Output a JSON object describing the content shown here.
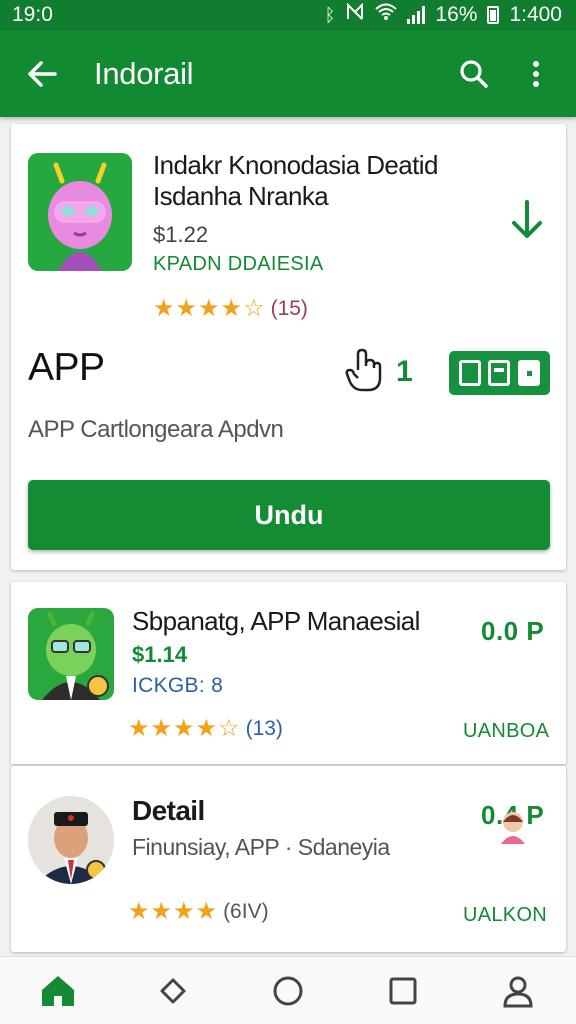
{
  "status_bar": {
    "time_left": "19:0",
    "battery": "16%",
    "time_right": "1:400",
    "icons": [
      "bluetooth-icon",
      "mute-icon",
      "wifi-icon",
      "signal-icon",
      "battery-icon"
    ]
  },
  "app_bar": {
    "title": "Indorail",
    "icons": [
      "back-arrow-icon",
      "search-icon",
      "more-vert-icon"
    ]
  },
  "featured": {
    "title_line1": "Indakr Knonodasia Deatid",
    "title_line2": "Isdanha Nranka",
    "price": "$1.22",
    "developer": "KPADN DDAIESIA",
    "stars": "★★★★☆",
    "rating_count": "(15)",
    "app_label": "APP",
    "hand_count": "1",
    "subtitle": "APP Cartlongeara Apdvn",
    "button_label": "Undu",
    "accent": "#148c34"
  },
  "items": [
    {
      "title": "Sbpanatg, APP Manaesial",
      "price": "$1.14",
      "tag": "ICKGB: 8",
      "stars": "★★★★☆",
      "rating_count": "(13)",
      "right_price": "0.0 P",
      "right_action": "UANBOA"
    },
    {
      "title": "Detail",
      "subtitle": "Finunsiay, APP · Sdaneyia",
      "stars": "★★★★",
      "rating_count": "(6IV)",
      "right_price": "0.4 P",
      "right_action": "UALKON"
    }
  ],
  "bottom_nav": {
    "icons": [
      "home-icon",
      "diamond-nav-icon",
      "circle-nav-icon",
      "square-nav-icon",
      "profile-icon"
    ]
  },
  "colors": {
    "status_bar": "#117d2e",
    "app_bar": "#128a32",
    "accent_green": "#148c34",
    "star": "#f2a21a"
  }
}
